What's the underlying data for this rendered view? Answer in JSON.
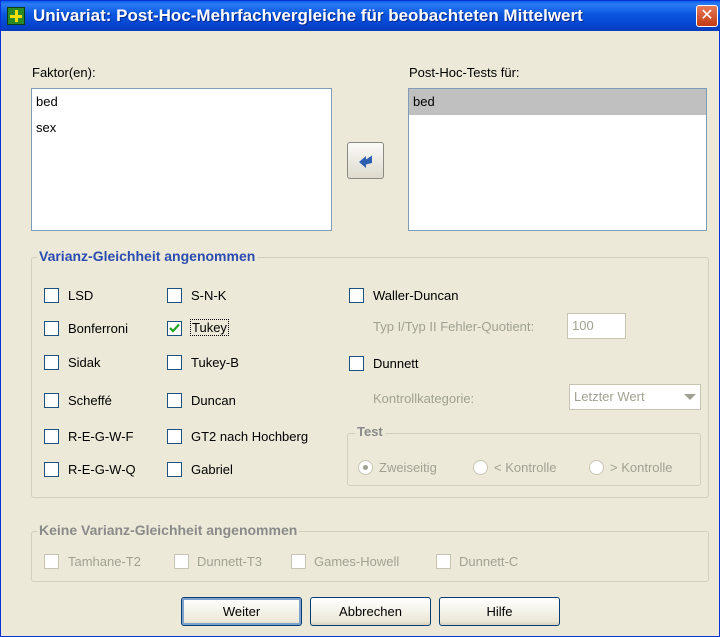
{
  "window": {
    "title": "Univariat: Post-Hoc-Mehrfachvergleiche für beobachteten Mittelwert",
    "close_symbol": "✕"
  },
  "factors": {
    "label": "Faktor(en):",
    "items": [
      "bed",
      "sex"
    ]
  },
  "posthoc": {
    "label": "Post-Hoc-Tests für:",
    "items": [
      "bed"
    ]
  },
  "move_button_icon": "arrow-left-icon",
  "equal_variance": {
    "title": "Varianz-Gleichheit angenommen",
    "col1": [
      {
        "label": "LSD",
        "checked": false
      },
      {
        "label": "Bonferroni",
        "checked": false
      },
      {
        "label": "Sidak",
        "checked": false
      },
      {
        "label": "Scheffé",
        "checked": false
      },
      {
        "label": "R-E-G-W-F",
        "checked": false
      },
      {
        "label": "R-E-G-W-Q",
        "checked": false
      }
    ],
    "col2": [
      {
        "label": "S-N-K",
        "checked": false
      },
      {
        "label": "Tukey",
        "checked": true
      },
      {
        "label": "Tukey-B",
        "checked": false
      },
      {
        "label": "Duncan",
        "checked": false
      },
      {
        "label": "GT2 nach Hochberg",
        "checked": false
      },
      {
        "label": "Gabriel",
        "checked": false
      }
    ],
    "waller_duncan": {
      "label": "Waller-Duncan",
      "checked": false
    },
    "error_ratio": {
      "label": "Typ I/Typ II Fehler-Quotient:",
      "value": "100"
    },
    "dunnett": {
      "label": "Dunnett",
      "checked": false
    },
    "control_category": {
      "label": "Kontrollkategorie:",
      "value": "Letzter Wert"
    },
    "test": {
      "title": "Test",
      "options": [
        {
          "label": "Zweiseitig",
          "selected": true
        },
        {
          "label": "< Kontrolle",
          "selected": false
        },
        {
          "label": "> Kontrolle",
          "selected": false
        }
      ]
    }
  },
  "unequal_variance": {
    "title": "Keine Varianz-Gleichheit angenommen",
    "items": [
      {
        "label": "Tamhane-T2",
        "checked": false
      },
      {
        "label": "Dunnett-T3",
        "checked": false
      },
      {
        "label": "Games-Howell",
        "checked": false
      },
      {
        "label": "Dunnett-C",
        "checked": false
      }
    ]
  },
  "buttons": {
    "continue": "Weiter",
    "cancel": "Abbrechen",
    "help": "Hilfe"
  },
  "colors": {
    "titlebar": "#0a56e0",
    "group_title": "#2a4cb0",
    "window_bg": "#ece9d8",
    "selected_item_bg": "#c0c0c0",
    "close_button": "#c23a12"
  }
}
